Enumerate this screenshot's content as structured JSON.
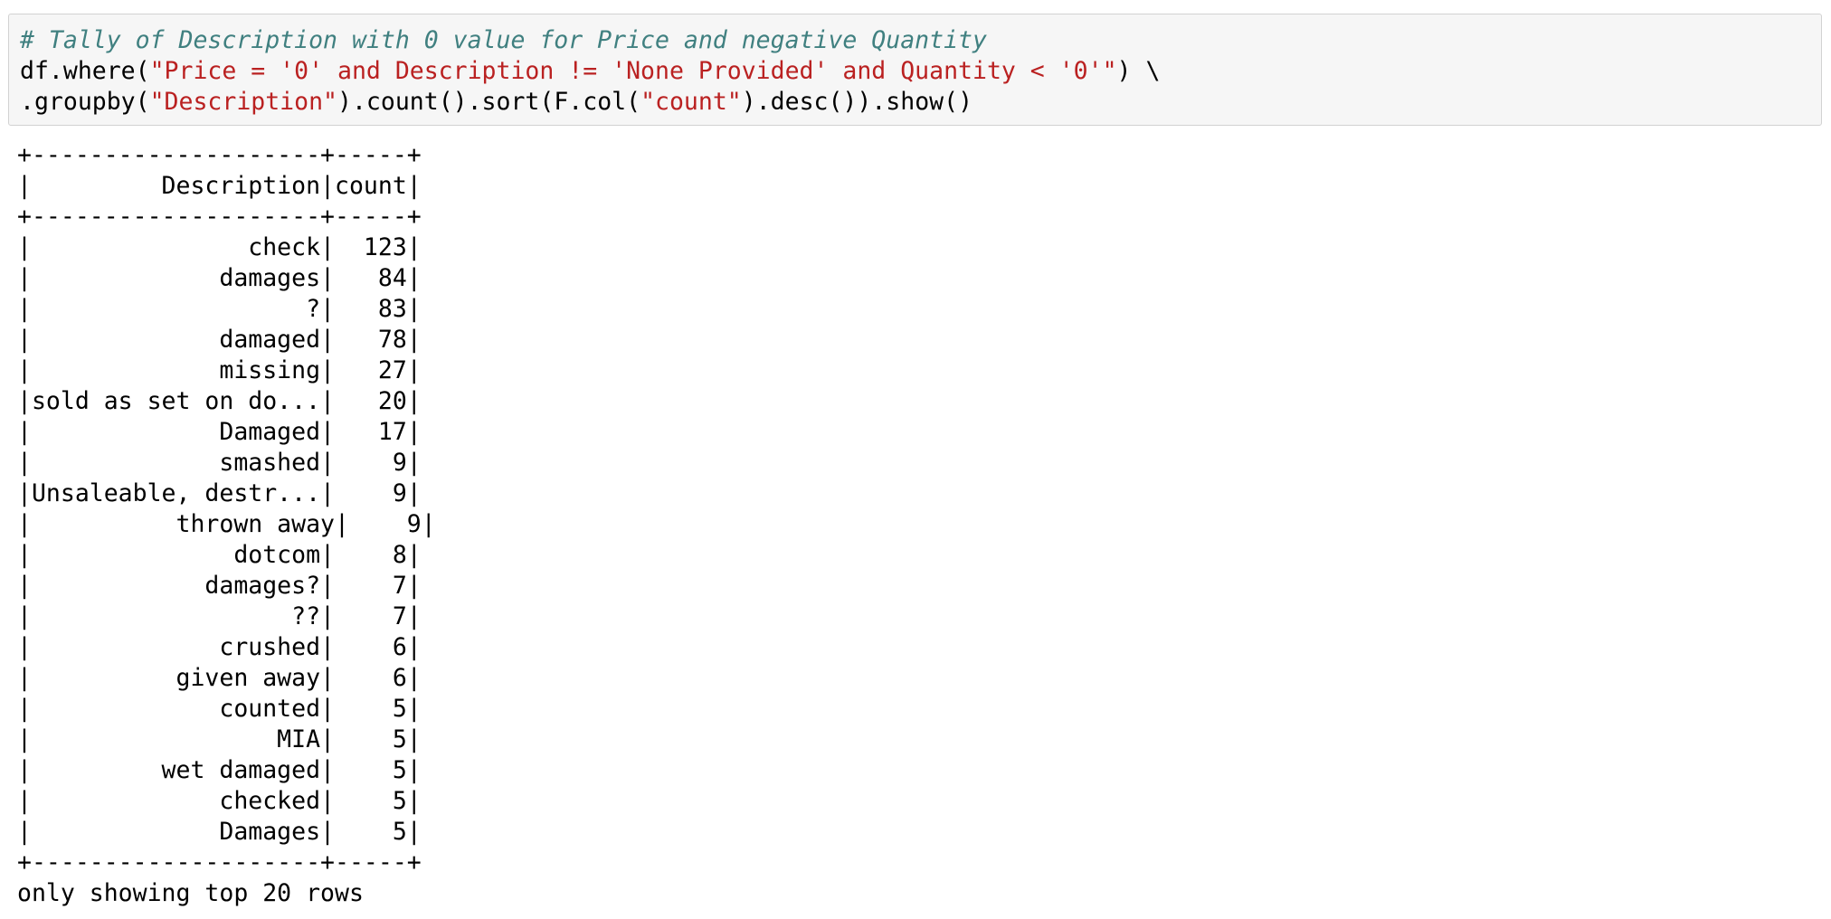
{
  "code_cell": {
    "comment": "# Tally of Description with 0 value for Price and negative Quantity",
    "line2": {
      "prefix": "df.where(",
      "string": "\"Price = '0' and Description != 'None Provided' and Quantity < '0'\"",
      "suffix": ") \\"
    },
    "line3": {
      "prefix": ".groupby(",
      "string1": "\"Description\"",
      "middle": ").count().sort(F.col(",
      "string2": "\"count\"",
      "suffix": ").desc()).show()"
    }
  },
  "output": {
    "border_top": "+--------------------+-----+",
    "header": "|         Description|count|",
    "border_mid": "+--------------------+-----+",
    "rows": [
      "|               check|  123|",
      "|             damages|   84|",
      "|                   ?|   83|",
      "|             damaged|   78|",
      "|             missing|   27|",
      "|sold as set on do...|   20|",
      "|             Damaged|   17|",
      "|             smashed|    9|",
      "|Unsaleable, destr...|    9|",
      "|          thrown away|    9|",
      "|              dotcom|    8|",
      "|            damages?|    7|",
      "|                  ??|    7|",
      "|             crushed|    6|",
      "|          given away|    6|",
      "|             counted|    5|",
      "|                 MIA|    5|",
      "|         wet damaged|    5|",
      "|             checked|    5|",
      "|             Damages|    5|"
    ],
    "border_bottom": "+--------------------+-----+",
    "footer": "only showing top 20 rows"
  }
}
